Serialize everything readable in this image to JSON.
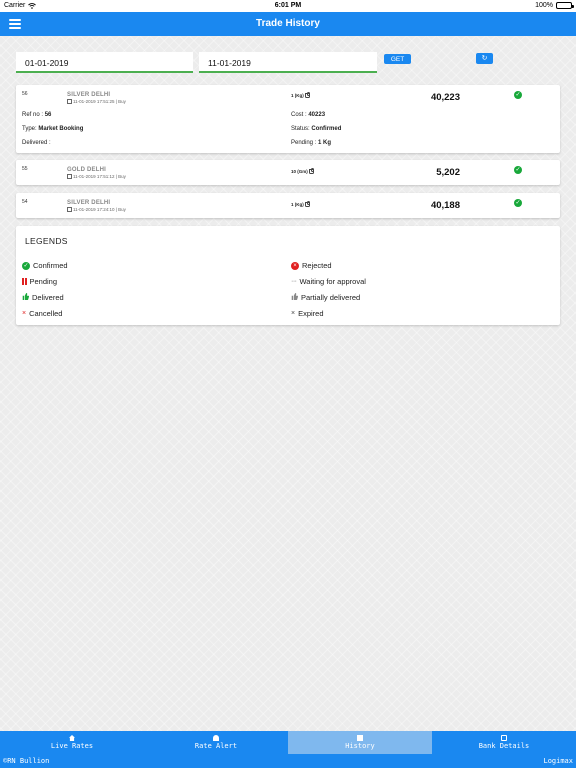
{
  "status_bar": {
    "carrier": "Carrier",
    "wifi_icon": "wifi-icon",
    "time": "6:01 PM",
    "battery": "100%",
    "battery_level": 1.0
  },
  "header": {
    "title": "Trade History",
    "menu_icon": "hamburger-menu-icon"
  },
  "filter": {
    "from_date": "01-01-2019",
    "to_date": "11-01-2019",
    "get_label": "GET",
    "refresh_icon": "↻"
  },
  "trades": [
    {
      "ref": "56",
      "product": "SILVER DELHI",
      "datetime": "11-01-2019 17:51:25 | Buy",
      "qty": "1 (Kg)",
      "amount": "40,223",
      "status_icon": "✓",
      "details": {
        "ref_label": "Ref no :",
        "ref_value": "56",
        "cost_label": "Cost :",
        "cost_value": "40223",
        "type_label": "Type:",
        "type_value": "Market Booking",
        "status_label": "Status:",
        "status_value": "Confirmed",
        "delivered_label": "Delivered :",
        "pending_label": "Pending :",
        "pending_value": "1 Kg"
      }
    },
    {
      "ref": "55",
      "product": "GOLD DELHI",
      "datetime": "11-01-2019 17:51:12 | Buy",
      "qty": "10 (Gm)",
      "amount": "5,202",
      "status_icon": "✓"
    },
    {
      "ref": "54",
      "product": "SILVER DELHI",
      "datetime": "11-01-2019 17:24:10 | Buy",
      "qty": "1 (Kg)",
      "amount": "40,188",
      "status_icon": "✓"
    }
  ],
  "legends": {
    "title": "LEGENDS",
    "confirmed": "Confirmed",
    "rejected": "Rejected",
    "pending": "Pending",
    "waiting": "Waiting for approval",
    "delivered": "Delivered",
    "partially_delivered": "Partially delivered",
    "cancelled": "Cancelled",
    "expired": "Expired",
    "icons": {
      "check": "✓",
      "cross": "×",
      "dots": "···",
      "thumb": "👍"
    }
  },
  "tabs": [
    {
      "label": "Live Rates",
      "icon": "home-icon"
    },
    {
      "label": "Rate Alert",
      "icon": "bell-icon"
    },
    {
      "label": "History",
      "icon": "history-icon",
      "active": true
    },
    {
      "label": "Bank Details",
      "icon": "bank-card-icon"
    }
  ],
  "footer": {
    "left": "©RN Bullion",
    "right": "Logimax"
  },
  "colors": {
    "primary": "#1a88f0",
    "active_tab": "#7fb8ee",
    "confirmed": "#18a83a",
    "rejected": "#e02020",
    "date_underline": "#4caf50"
  }
}
